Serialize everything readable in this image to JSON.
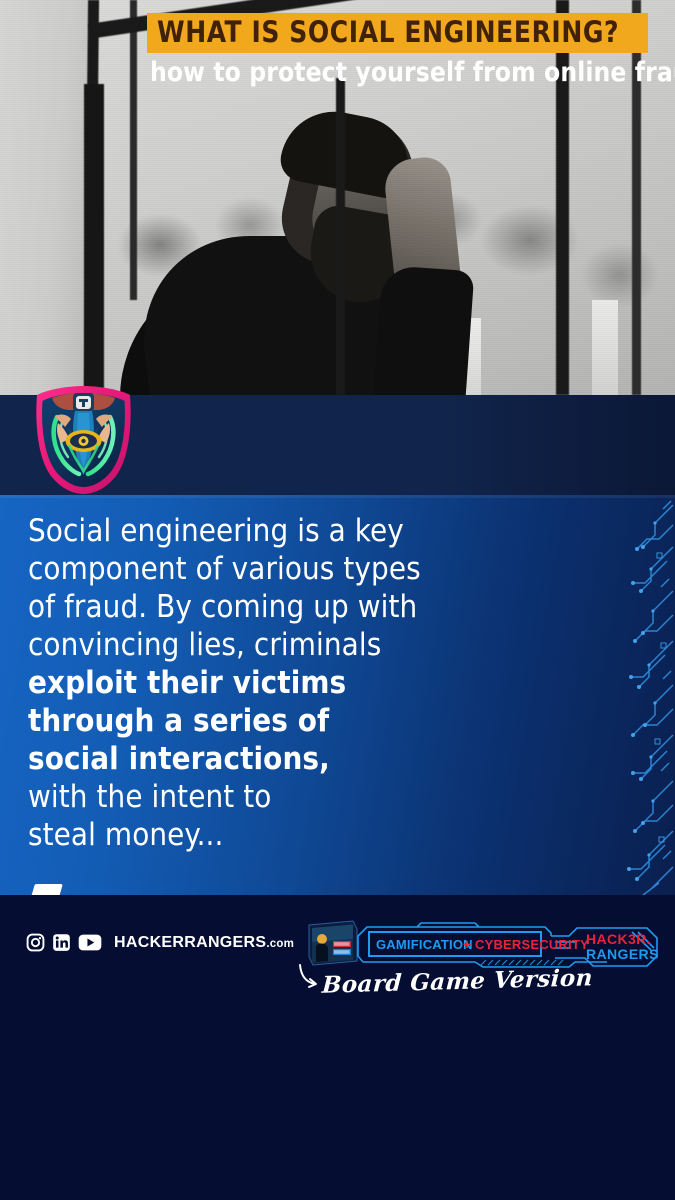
{
  "post": {
    "photo": {
      "alt_description": "black and white photo of a worried bearded man resting his head on his hand by a window"
    },
    "header": {
      "title": "WHAT IS SOCIAL ENGINEERING?",
      "subtitle": "how to protect yourself from online fraud",
      "badge_name": "hacker-rangers-shield-badge",
      "title_bg_color": "#f2a81d",
      "title_text_color": "#40210a",
      "band_color": "#11244b"
    },
    "body": {
      "lines": [
        {
          "text": "Social engineering is a key",
          "bold": false
        },
        {
          "text": "component of various types",
          "bold": false
        },
        {
          "text": "of fraud. By coming up with",
          "bold": false
        },
        {
          "text": "convincing lies, criminals",
          "bold": false
        },
        {
          "text": "exploit their victims",
          "bold": true
        },
        {
          "text": "through a series of",
          "bold": true
        },
        {
          "text": "social interactions,",
          "bold": true
        },
        {
          "text": "with the intent to",
          "bold": false
        },
        {
          "text": "steal money...",
          "bold": false
        }
      ],
      "gradient_from": "#1665c3",
      "gradient_to": "#0a1f4f"
    },
    "footer": {
      "social_icons": [
        "instagram-icon",
        "linkedin-icon",
        "youtube-icon"
      ],
      "website": "HACKERRANGERS",
      "website_tld": ".com",
      "game_banner": {
        "word1": "GAMIFICATION",
        "plus": "+",
        "word2": "CYBERSECURITY",
        "logo_line1": "HACK3R.",
        "logo_line2": "RANGERS",
        "blue": "#1e9bf0",
        "red": "#e8243c"
      },
      "handwriting": "Board Game Version",
      "background": "#050e32"
    }
  }
}
